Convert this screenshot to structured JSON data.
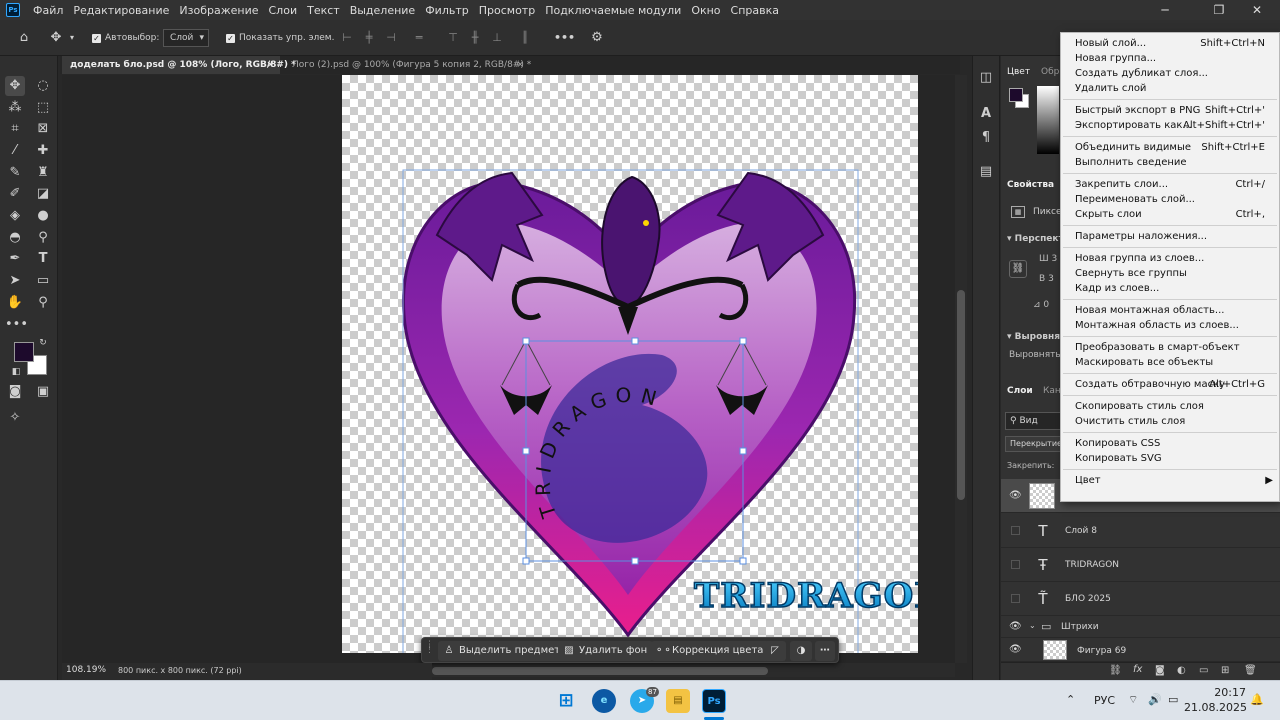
{
  "app": {
    "menu": [
      "Файл",
      "Редактирование",
      "Изображение",
      "Слои",
      "Текст",
      "Выделение",
      "Фильтр",
      "Просмотр",
      "Подключаемые модули",
      "Окно",
      "Справка"
    ],
    "logo_text": "Ps"
  },
  "options_bar": {
    "autoselect_label": "Автовыбор:",
    "autoselect_target": "Слой",
    "show_transform_label": "Показать упр. элем.",
    "more": "•••"
  },
  "tabs": [
    {
      "label": "доделать бло.psd @ 108% (Лого, RGB/8#) *",
      "close": "×",
      "active": true
    },
    {
      "label": "Лого (2).psd @ 100% (Фигура 5 копия 2, RGB/8#) *",
      "close": "×",
      "active": false
    }
  ],
  "status": {
    "zoom": "108.19%",
    "doc_info": "800 пикс. x 800 пикс. (72 ppi)"
  },
  "canvas": {
    "circle_text": "TRIDRAGON",
    "logo_text": "TRIDRAGON"
  },
  "context_taskbar": {
    "select_subject": "Выделить предмет",
    "remove_bg": "Удалить фон",
    "color_correction": "Коррекция цвета"
  },
  "panels": {
    "color_tab": "Цвет",
    "patterns_tab": "Обр",
    "properties_tab": "Свойства",
    "pixel_layer": "Пиксе",
    "perspective": "Перспект",
    "w_label": "Ш",
    "w_value": "3",
    "h_label": "В",
    "h_value": "3",
    "angle_value": "0",
    "align_section": "Выровня",
    "align_label": "Выровнять:",
    "layers_tab": "Слои",
    "channels_tab": "Кан",
    "filter_label": "Вид",
    "blend_mode": "Перекрытие",
    "lock_label": "Закрепить:"
  },
  "layers": [
    {
      "name": "",
      "kind": "pixel",
      "visible": true,
      "selected": true
    },
    {
      "name": "Слой 8",
      "kind": "text",
      "visible": false
    },
    {
      "name": "TRIDRAGON",
      "kind": "warp-text",
      "visible": false
    },
    {
      "name": "БЛО  2025",
      "kind": "text-path",
      "visible": false
    },
    {
      "name": "Штрихи",
      "kind": "group",
      "visible": true
    },
    {
      "name": "Фигура 69",
      "kind": "shape",
      "visible": true
    }
  ],
  "context_menu": {
    "groups": [
      [
        {
          "label": "Новый слой...",
          "shortcut": "Shift+Ctrl+N"
        },
        {
          "label": "Новая группа...",
          "shortcut": ""
        },
        {
          "label": "Создать дубликат слоя...",
          "shortcut": ""
        },
        {
          "label": "Удалить слой",
          "shortcut": ""
        }
      ],
      [
        {
          "label": "Быстрый экспорт в PNG",
          "shortcut": "Shift+Ctrl+'"
        },
        {
          "label": "Экспортировать как...",
          "shortcut": "Alt+Shift+Ctrl+'"
        }
      ],
      [
        {
          "label": "Объединить видимые",
          "shortcut": "Shift+Ctrl+E"
        },
        {
          "label": "Выполнить сведение",
          "shortcut": ""
        }
      ],
      [
        {
          "label": "Закрепить слои...",
          "shortcut": "Ctrl+/"
        },
        {
          "label": "Переименовать слой...",
          "shortcut": ""
        },
        {
          "label": "Скрыть слои",
          "shortcut": "Ctrl+,"
        }
      ],
      [
        {
          "label": "Параметры наложения...",
          "shortcut": ""
        }
      ],
      [
        {
          "label": "Новая группа из слоев...",
          "shortcut": ""
        },
        {
          "label": "Свернуть все группы",
          "shortcut": ""
        },
        {
          "label": "Кадр из слоев...",
          "shortcut": ""
        }
      ],
      [
        {
          "label": "Новая монтажная область...",
          "shortcut": ""
        },
        {
          "label": "Монтажная область из слоев...",
          "shortcut": ""
        }
      ],
      [
        {
          "label": "Преобразовать в смарт-объект",
          "shortcut": ""
        },
        {
          "label": "Маскировать все объекты",
          "shortcut": ""
        }
      ],
      [
        {
          "label": "Создать обтравочную маску",
          "shortcut": "Alt+Ctrl+G"
        }
      ],
      [
        {
          "label": "Скопировать стиль слоя",
          "shortcut": ""
        },
        {
          "label": "Очистить стиль слоя",
          "shortcut": ""
        }
      ],
      [
        {
          "label": "Копировать CSS",
          "shortcut": ""
        },
        {
          "label": "Копировать SVG",
          "shortcut": ""
        }
      ],
      [
        {
          "label": "Цвет",
          "shortcut": "▶"
        }
      ]
    ]
  },
  "taskbar": {
    "language": "РУС",
    "time": "20:17",
    "date": "21.08.2025",
    "telegram_badge": "87"
  },
  "colors": {
    "foreground": "#1d0a2c",
    "background": "#ffffff",
    "accent": "#31a8ff"
  }
}
